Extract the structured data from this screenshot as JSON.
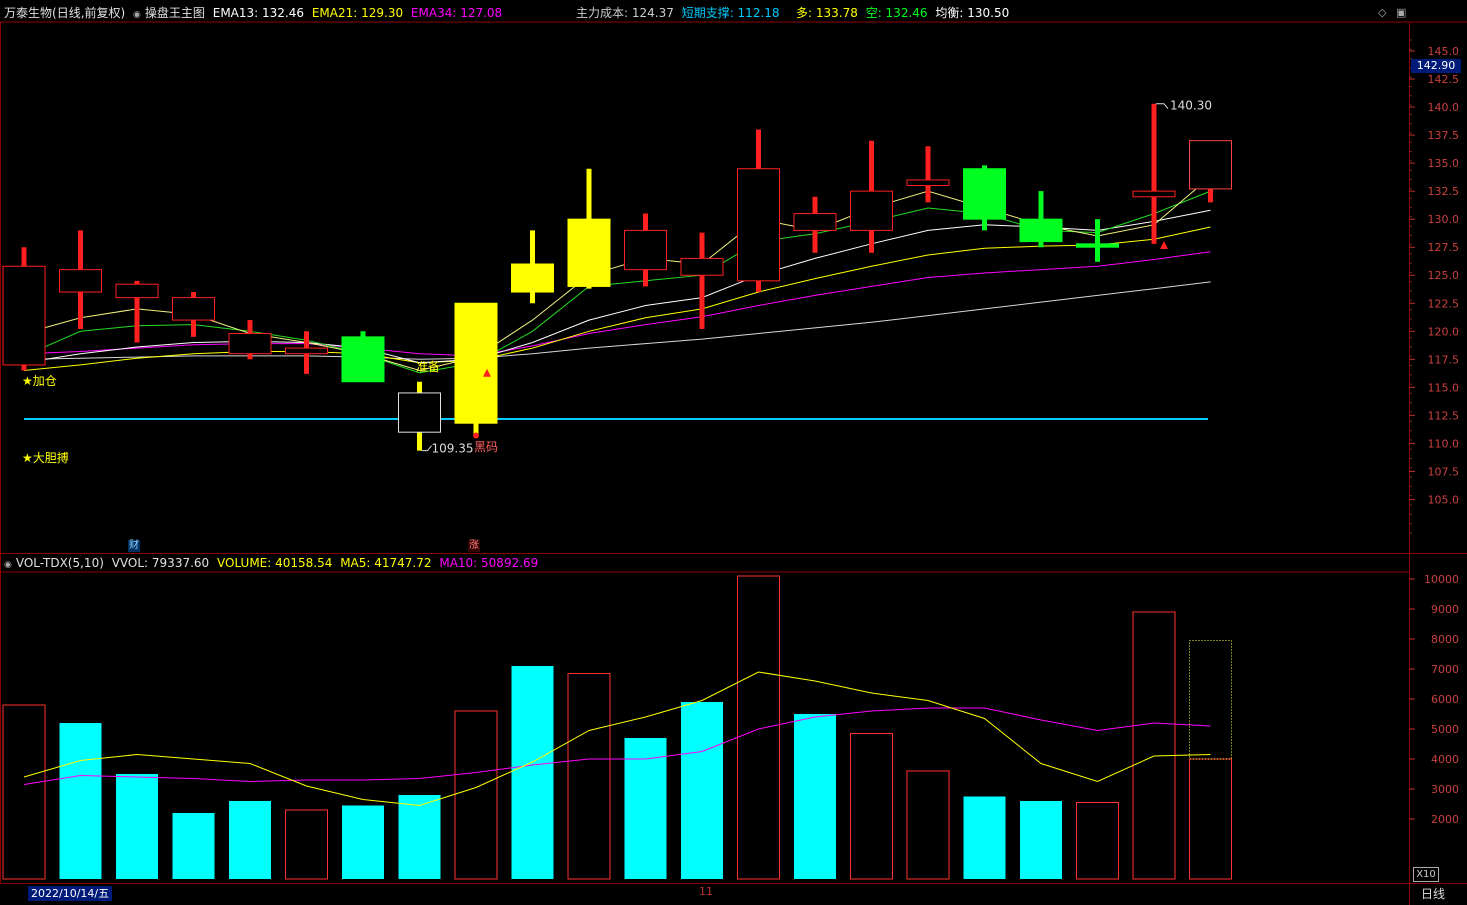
{
  "header": {
    "stock": "万泰生物",
    "period_info": "(日线,前复权)",
    "indicator_name": "操盘王主图",
    "ema13": "EMA13: 132.46",
    "ema21": "EMA21: 129.30",
    "ema34": "EMA34: 127.08",
    "cost": "主力成本: 124.37",
    "support": "短期支撑: 112.18",
    "bull": "多: 133.78",
    "bear": "空: 132.46",
    "balance": "均衡: 130.50"
  },
  "volume_header": {
    "name": "VOL-TDX(5,10)",
    "vvol": "VVOL: 79337.60",
    "volume": "VOLUME: 40158.54",
    "ma5": "MA5: 41747.72",
    "ma10": "MA10: 50892.69"
  },
  "current_price_badge": "142.90",
  "date_badge": "2022/10/14/五",
  "period_tab": "日线",
  "vol_unit_badge": "X10",
  "month_mark": "11",
  "event_badges": [
    "财",
    "涨"
  ],
  "annotations": {
    "jiacang": "★加仓",
    "dadanbo": "★大胆搏",
    "zhunbei": "准备",
    "heima": "黑码",
    "high_label": "140.30",
    "low_label": "109.35"
  },
  "colors": {
    "up": "#ff2020",
    "down_green": "#00ff20",
    "down_yellow": "#ffff00",
    "vol_down": "#00ffff",
    "ema13": "#ffffff",
    "ema21": "#ffff00",
    "ema34": "#ff00ff",
    "support": "#00ccff",
    "grid": "#8b0000"
  },
  "chart_data": [
    {
      "type": "candlestick",
      "price_axis": {
        "min": 104,
        "max": 146,
        "ticks": [
          105.0,
          107.5,
          110.0,
          112.5,
          115.0,
          117.5,
          120.0,
          122.5,
          125.0,
          127.5,
          130.0,
          132.5,
          135.0,
          137.5,
          140.0,
          142.5,
          145.0
        ]
      },
      "candles": [
        {
          "o": 117.0,
          "h": 127.5,
          "l": 116.5,
          "c": 125.8,
          "style": "up"
        },
        {
          "o": 123.5,
          "h": 129.0,
          "l": 120.2,
          "c": 125.5,
          "style": "up"
        },
        {
          "o": 123.0,
          "h": 124.5,
          "l": 119.0,
          "c": 124.2,
          "style": "up"
        },
        {
          "o": 121.0,
          "h": 123.5,
          "l": 119.5,
          "c": 123.0,
          "style": "up"
        },
        {
          "o": 118.0,
          "h": 121.0,
          "l": 117.5,
          "c": 119.8,
          "style": "up"
        },
        {
          "o": 118.0,
          "h": 120.0,
          "l": 116.2,
          "c": 118.5,
          "style": "up"
        },
        {
          "o": 119.5,
          "h": 120.0,
          "l": 115.5,
          "c": 115.5,
          "style": "green"
        },
        {
          "o": 114.5,
          "h": 115.5,
          "l": 109.35,
          "c": 111.0,
          "style": "yellow_hollow"
        },
        {
          "o": 122.5,
          "h": 122.5,
          "l": 110.8,
          "c": 111.8,
          "style": "yellow"
        },
        {
          "o": 126.0,
          "h": 129.0,
          "l": 122.5,
          "c": 123.5,
          "style": "yellow"
        },
        {
          "o": 130.0,
          "h": 134.5,
          "l": 123.8,
          "c": 124.0,
          "style": "yellow"
        },
        {
          "o": 125.5,
          "h": 130.5,
          "l": 124.0,
          "c": 129.0,
          "style": "up"
        },
        {
          "o": 125.0,
          "h": 128.8,
          "l": 120.2,
          "c": 126.5,
          "style": "up"
        },
        {
          "o": 124.5,
          "h": 138.0,
          "l": 123.5,
          "c": 134.5,
          "style": "up"
        },
        {
          "o": 129.0,
          "h": 132.0,
          "l": 127.0,
          "c": 130.5,
          "style": "up"
        },
        {
          "o": 129.0,
          "h": 137.0,
          "l": 127.0,
          "c": 132.5,
          "style": "up"
        },
        {
          "o": 133.0,
          "h": 136.5,
          "l": 131.5,
          "c": 133.5,
          "style": "up"
        },
        {
          "o": 134.5,
          "h": 134.8,
          "l": 129.0,
          "c": 130.0,
          "style": "green"
        },
        {
          "o": 130.0,
          "h": 132.5,
          "l": 127.5,
          "c": 128.0,
          "style": "green"
        },
        {
          "o": 127.8,
          "h": 130.0,
          "l": 126.2,
          "c": 127.5,
          "style": "green"
        },
        {
          "o": 132.0,
          "h": 140.3,
          "l": 127.8,
          "c": 132.5,
          "style": "up"
        },
        {
          "o": 132.7,
          "h": 134.5,
          "l": 131.5,
          "c": 137.0,
          "style": "up_hollow_tall"
        }
      ],
      "lines": {
        "ema13": [
          117.2,
          118.0,
          118.6,
          119.0,
          119.1,
          119.0,
          118.5,
          117.2,
          117.5,
          119.0,
          121.0,
          122.3,
          123.0,
          125.0,
          126.5,
          127.8,
          129.0,
          129.5,
          129.3,
          129.0,
          129.8,
          130.8
        ],
        "ema21": [
          116.5,
          117.0,
          117.6,
          118.0,
          118.2,
          118.2,
          118.0,
          117.2,
          117.4,
          118.5,
          120.0,
          121.2,
          122.0,
          123.5,
          124.7,
          125.8,
          126.8,
          127.4,
          127.6,
          127.7,
          128.2,
          129.3
        ],
        "ema34": [
          118.0,
          118.2,
          118.5,
          118.8,
          118.9,
          118.9,
          118.5,
          118.0,
          117.8,
          118.7,
          119.8,
          120.6,
          121.3,
          122.3,
          123.2,
          124.0,
          124.8,
          125.2,
          125.5,
          125.8,
          126.4,
          127.1
        ],
        "cost": [
          117.5,
          117.6,
          117.7,
          117.8,
          117.8,
          117.8,
          117.7,
          117.5,
          117.6,
          118.0,
          118.5,
          118.9,
          119.3,
          119.8,
          120.3,
          120.8,
          121.4,
          122.0,
          122.6,
          123.2,
          123.8,
          124.4
        ],
        "fast": [
          119.8,
          121.2,
          122.0,
          121.5,
          119.8,
          119.0,
          118.0,
          116.5,
          117.7,
          121.0,
          125.0,
          126.5,
          126.0,
          130.0,
          129.0,
          131.0,
          132.5,
          131.0,
          129.5,
          128.5,
          129.5,
          133.8
        ],
        "green": [
          117.8,
          120.0,
          120.5,
          120.6,
          120.0,
          119.2,
          118.0,
          116.3,
          117.2,
          120.0,
          124.0,
          124.5,
          125.0,
          128.0,
          128.7,
          129.8,
          131.0,
          130.5,
          129.0,
          128.8,
          130.5,
          132.5
        ]
      },
      "support_line": 112.18,
      "current_price": 142.9
    },
    {
      "type": "volume",
      "y_axis": {
        "min": 0,
        "max": 10800,
        "ticks": [
          2000,
          3000,
          4000,
          5000,
          6000,
          7000,
          8000,
          9000,
          10000
        ],
        "unit": "X10"
      },
      "bars": [
        5800,
        5200,
        3500,
        2200,
        2600,
        2300,
        2450,
        2800,
        5600,
        7100,
        6850,
        4700,
        5900,
        10100,
        5500,
        4850,
        3600,
        2750,
        2600,
        2550,
        8900,
        4000
      ],
      "bar_styles": [
        "hollow",
        "cyan",
        "cyan",
        "cyan",
        "cyan",
        "hollow",
        "cyan",
        "cyan",
        "hollow",
        "cyan",
        "hollow",
        "cyan",
        "cyan",
        "hollow",
        "cyan",
        "hollow",
        "hollow",
        "cyan",
        "cyan",
        "hollow",
        "hollow",
        "hollow"
      ],
      "ma5": [
        3400,
        3950,
        4150,
        4000,
        3850,
        3100,
        2650,
        2450,
        3050,
        3900,
        4950,
        5400,
        5950,
        6900,
        6600,
        6200,
        5950,
        5350,
        3850,
        3250,
        4100,
        4150
      ],
      "ma10": [
        3150,
        3450,
        3400,
        3350,
        3250,
        3300,
        3300,
        3350,
        3550,
        3800,
        4000,
        4000,
        4250,
        5000,
        5400,
        5600,
        5700,
        5700,
        5300,
        4950,
        5200,
        5100
      ],
      "last_partial": 7950
    }
  ]
}
